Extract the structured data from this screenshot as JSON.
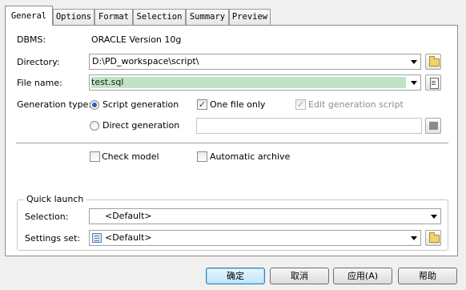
{
  "tabs": [
    {
      "label": "General"
    },
    {
      "label": "Options"
    },
    {
      "label": "Format"
    },
    {
      "label": "Selection"
    },
    {
      "label": "Summary"
    },
    {
      "label": "Preview"
    }
  ],
  "general": {
    "dbms_label": "DBMS:",
    "dbms_value": "ORACLE Version 10g",
    "directory_label": "Directory:",
    "directory_value": "D:\\PD_workspace\\script\\",
    "filename_label": "File name:",
    "filename_value": "test.sql",
    "generation_type_label": "Generation type:",
    "script_generation": "Script generation",
    "direct_generation": "Direct generation",
    "one_file_only": "One file only",
    "edit_generation_script": "Edit generation script",
    "check_model": "Check model",
    "automatic_archive": "Automatic archive"
  },
  "quick_launch": {
    "title": "Quick launch",
    "selection_label": "Selection:",
    "selection_value": "<Default>",
    "settings_label": "Settings set:",
    "settings_value": "<Default>"
  },
  "buttons": {
    "ok": "确定",
    "cancel": "取消",
    "apply": "应用(A)",
    "help": "帮助"
  }
}
